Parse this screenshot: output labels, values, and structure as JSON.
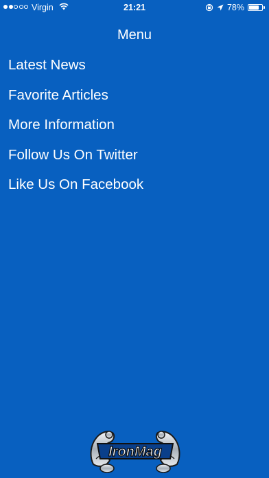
{
  "status_bar": {
    "signal_filled": 2,
    "signal_total": 5,
    "carrier": "Virgin",
    "time": "21:21",
    "battery_percent": "78%",
    "battery_level": 0.78
  },
  "menu": {
    "title": "Menu",
    "items": [
      {
        "label": "Latest News"
      },
      {
        "label": "Favorite Articles"
      },
      {
        "label": "More Information"
      },
      {
        "label": "Follow Us On Twitter"
      },
      {
        "label": "Like Us On Facebook"
      }
    ]
  },
  "logo": {
    "text": "IronMag",
    "icon": "ironmag-logo-icon"
  },
  "colors": {
    "background": "#0860C0",
    "text": "#ffffff"
  }
}
